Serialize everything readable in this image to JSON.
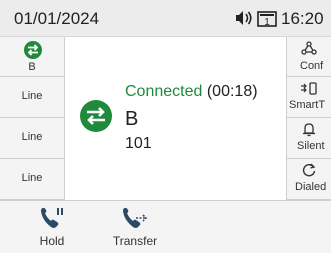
{
  "status_bar": {
    "date": "01/01/2024",
    "line_badge": "1",
    "time": "16:20"
  },
  "left_keys": [
    {
      "label": "B",
      "icon": "call-transfer-icon",
      "active": true
    },
    {
      "label": "Line"
    },
    {
      "label": "Line"
    },
    {
      "label": "Line"
    }
  ],
  "call": {
    "status": "Connected",
    "timer": "(00:18)",
    "name": "B",
    "number": "101"
  },
  "right_keys": [
    {
      "label": "Conf",
      "icon": "conference-icon"
    },
    {
      "label": "SmartT",
      "icon": "smart-transfer-icon"
    },
    {
      "label": "Silent",
      "icon": "bell-icon"
    },
    {
      "label": "Dialed",
      "icon": "redial-icon"
    }
  ],
  "bottom_keys": [
    {
      "label": "Hold",
      "icon": "hold-icon"
    },
    {
      "label": "Transfer",
      "icon": "transfer-icon"
    }
  ],
  "colors": {
    "accent_green": "#1f8a3b",
    "icon_green": "#1f8a3b"
  }
}
